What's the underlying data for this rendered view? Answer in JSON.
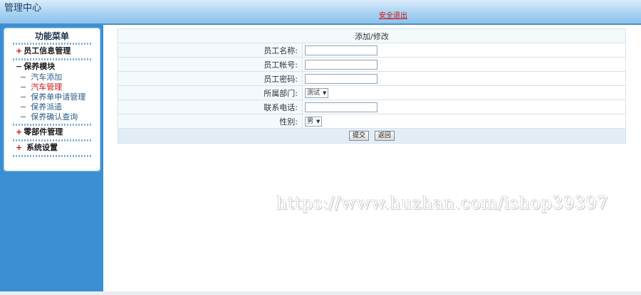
{
  "header": {
    "title": "管理中心",
    "logout_label": "安全退出"
  },
  "sidebar": {
    "title": "功能菜单",
    "groups": [
      {
        "label": "员工信息管理"
      },
      {
        "label": "保养模块",
        "items": [
          "汽车添加",
          "汽车管理",
          "保养单申请管理",
          "保养派遣",
          "保养确认查询"
        ]
      },
      {
        "label": "零部件管理"
      },
      {
        "label": "系统设置"
      }
    ]
  },
  "form": {
    "title": "添加/修改",
    "fields": {
      "name_label": "员工名称:",
      "account_label": "员工帐号:",
      "password_label": "员工密码:",
      "department_label": "所属部门:",
      "department_value": "测试",
      "phone_label": "联系电话:",
      "gender_label": "性别:",
      "gender_value": "男"
    },
    "submit_label": "提交",
    "back_label": "返回"
  },
  "watermark": "https://www.huzhan.com/ishop39397"
}
